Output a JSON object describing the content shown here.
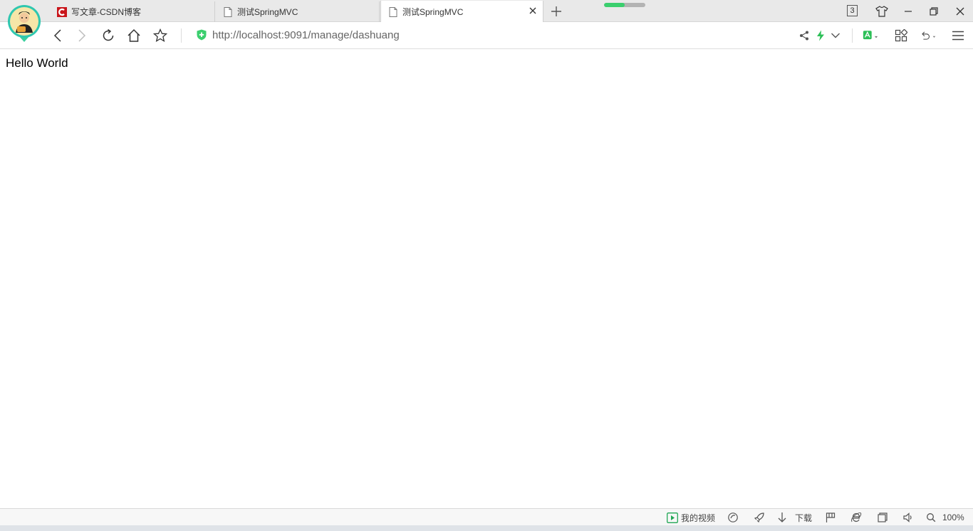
{
  "tabs": [
    {
      "title": "写文章-CSDN博客",
      "favicon": "csdn-logo-icon"
    },
    {
      "title": "测试SpringMVC",
      "favicon": "page-icon"
    },
    {
      "title": "测试SpringMVC",
      "favicon": "page-icon",
      "active": true
    }
  ],
  "tab_count": "3",
  "loading_progress": 0.5,
  "address": {
    "url": "http://localhost:9091/manage/dashuang"
  },
  "page": {
    "text": "Hello World"
  },
  "statusbar": {
    "video_label": "我的视频",
    "download_label": "下载",
    "zoom": "100%"
  },
  "colors": {
    "accent": "#3bcf6e",
    "csdn": "#c9161b",
    "video": "#22a756"
  }
}
